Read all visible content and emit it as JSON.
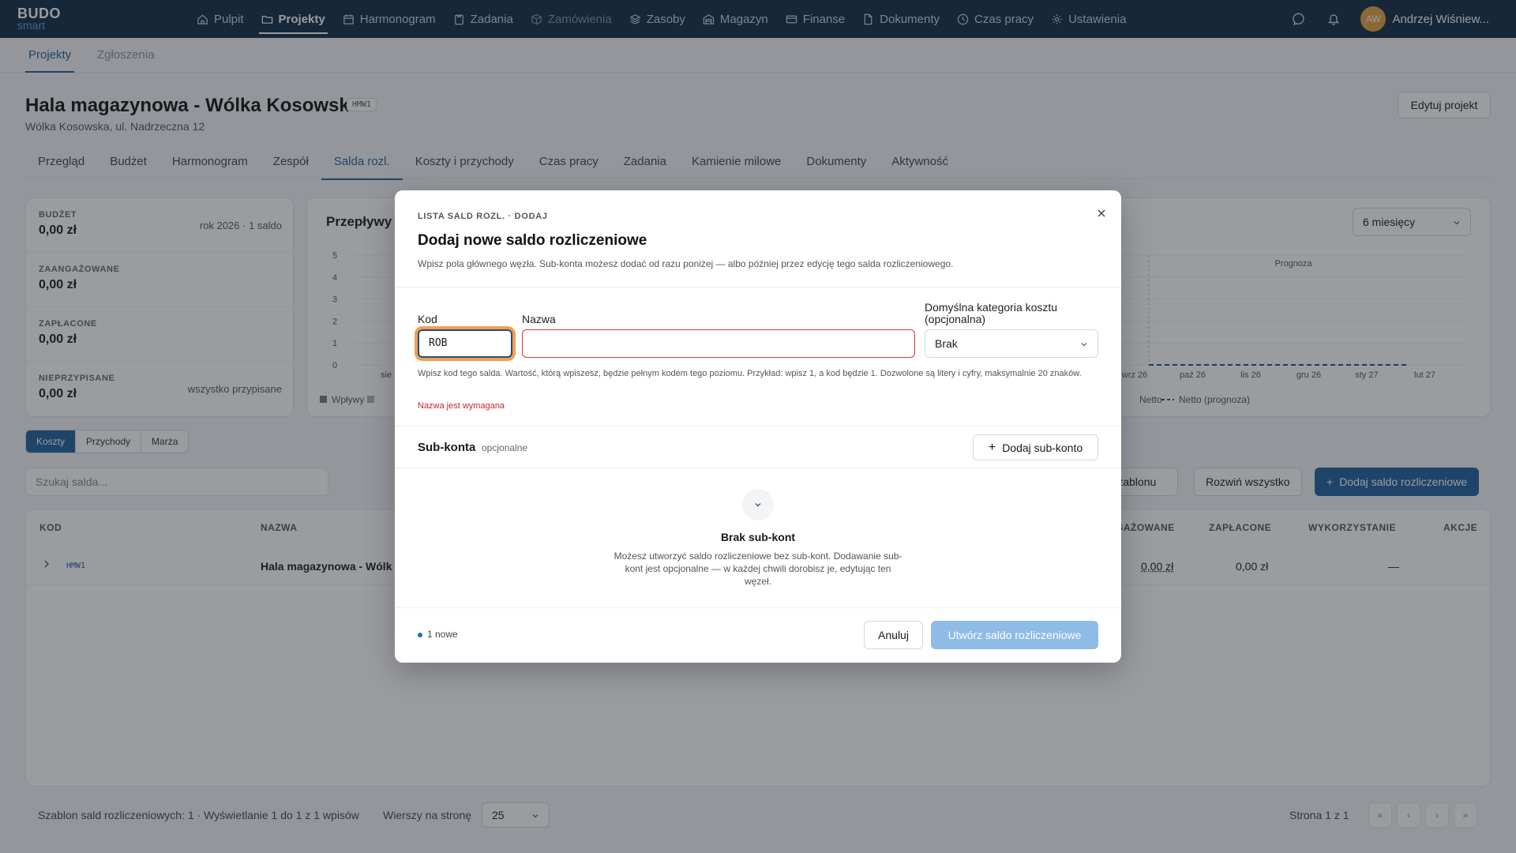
{
  "app": {
    "logo_top": "BUDO",
    "logo_bottom": "smart"
  },
  "nav": {
    "items": [
      {
        "label": "Pulpit",
        "icon": "home-icon"
      },
      {
        "label": "Projekty",
        "icon": "folder-icon",
        "active": true
      },
      {
        "label": "Harmonogram",
        "icon": "calendar-icon"
      },
      {
        "label": "Zadania",
        "icon": "clipboard-icon"
      },
      {
        "label": "Zamówienia",
        "icon": "package-icon",
        "dim": true
      },
      {
        "label": "Zasoby",
        "icon": "layers-icon"
      },
      {
        "label": "Magazyn",
        "icon": "warehouse-icon"
      },
      {
        "label": "Finanse",
        "icon": "card-icon"
      },
      {
        "label": "Dokumenty",
        "icon": "document-icon"
      },
      {
        "label": "Czas pracy",
        "icon": "clock-icon"
      },
      {
        "label": "Ustawienia",
        "icon": "gear-icon"
      }
    ],
    "user": {
      "initials": "AW",
      "name": "Andrzej Wiśniew..."
    }
  },
  "subtabs": [
    "Projekty",
    "Zgłoszenia"
  ],
  "project": {
    "title": "Hala magazynowa - Wólka Kosowska",
    "code": "HMW1",
    "address": "Wólka Kosowska, ul. Nadrzeczna 12",
    "edit_label": "Edytuj projekt",
    "tabs": [
      "Przegląd",
      "Budżet",
      "Harmonogram",
      "Zespół",
      "Salda rozl.",
      "Koszty i przychody",
      "Czas pracy",
      "Zadania",
      "Kamienie milowe",
      "Dokumenty",
      "Aktywność"
    ]
  },
  "kpis": [
    {
      "label": "BUDŻET",
      "value": "0,00 zł",
      "note": "rok 2026 · 1 saldo"
    },
    {
      "label": "ZAANGAŻOWANE",
      "value": "0,00 zł",
      "note": ""
    },
    {
      "label": "ZAPŁACONE",
      "value": "0,00 zł",
      "note": ""
    },
    {
      "label": "NIEPRZYPISANE",
      "value": "0,00 zł",
      "note": "wszystko przypisane"
    }
  ],
  "chart": {
    "title": "Przepływy p",
    "period": "6 miesięcy",
    "y_ticks": [
      "5",
      "4",
      "3",
      "2",
      "1",
      "0"
    ],
    "x_ticks_left": [
      "sie"
    ],
    "x_ticks_right": [
      "wrz 26",
      "paź 26",
      "lis 26",
      "gru 26",
      "sty 27",
      "lut 27"
    ],
    "forecast_label": "Prognoza",
    "legend": [
      "Wpływy",
      "Netto",
      "Netto (prognoza)"
    ]
  },
  "chart_data": {
    "type": "line",
    "x": [
      "sie",
      "wrz 26",
      "paź 26",
      "lis 26",
      "gru 26",
      "sty 27",
      "lut 27"
    ],
    "series": [
      {
        "name": "Wpływy",
        "values": [
          0,
          0,
          0,
          0,
          0,
          0,
          0
        ]
      },
      {
        "name": "Netto",
        "values": [
          0,
          0,
          0,
          0,
          0,
          0,
          0
        ]
      },
      {
        "name": "Netto (prognoza)",
        "values": [
          0,
          0,
          0,
          0,
          0,
          0,
          0
        ]
      }
    ],
    "ylim": [
      0,
      5
    ],
    "title": "Przepływy p"
  },
  "toggles": [
    "Koszty",
    "Przychody",
    "Marża"
  ],
  "search_placeholder": "Szukaj salda...",
  "table_buttons": {
    "template": "z Szablonu",
    "expand": "Rozwiń wszystko",
    "add": "Dodaj saldo rozliczeniowe"
  },
  "table": {
    "headers": {
      "kod": "KOD",
      "nazwa": "NAZWA",
      "zaang": "GAŻOWANE",
      "zapl": "ZAPŁACONE",
      "wyk": "WYKORZYSTANIE",
      "akcje": "AKCJE"
    },
    "row": {
      "kod": "HMW1",
      "nazwa": "Hala magazynowa - Wólk",
      "zaang": "0,00 zł",
      "zapl": "0,00 zł",
      "wyk": "—"
    }
  },
  "footer": {
    "summary": "Szablon sald rozliczeniowych: 1  ·  Wyświetlanie 1 do 1 z 1 wpisów",
    "rows_label": "Wierszy na stronę",
    "rows_value": "25",
    "page": "Strona 1 z 1"
  },
  "modal": {
    "eyebrow": "LISTA SALD ROZL. · DODAJ",
    "title": "Dodaj nowe saldo rozliczeniowe",
    "description": "Wpisz pola głównego węzła. Sub-konta możesz dodać od razu poniżej — albo później przez edycję tego salda rozliczeniowego.",
    "kod_label": "Kod",
    "kod_value": "ROB",
    "nazwa_label": "Nazwa",
    "nazwa_value": "",
    "category_label": "Domyślna kategoria kosztu (opcjonalna)",
    "category_value": "Brak",
    "hint": "Wpisz kod tego salda. Wartość, którą wpiszesz, będzie pełnym kodem tego poziomu. Przykład: wpisz 1, a kod będzie 1. Dozwolone są litery i cyfry, maksymalnie 20 znaków.",
    "error": "Nazwa jest wymagana",
    "subaccounts_title": "Sub-konta",
    "subaccounts_optional": "opcjonalne",
    "add_sub_label": "Dodaj sub-konto",
    "empty_title": "Brak sub-kont",
    "empty_text": "Możesz utworzyć saldo rozliczeniowe bez sub-kont. Dodawanie sub-kont jest opcjonalne — w każdej chwili dorobisz je, edytując ten węzeł.",
    "new_count": "1 nowe",
    "cancel_label": "Anuluj",
    "create_label": "Utwórz saldo rozliczeniowe"
  }
}
